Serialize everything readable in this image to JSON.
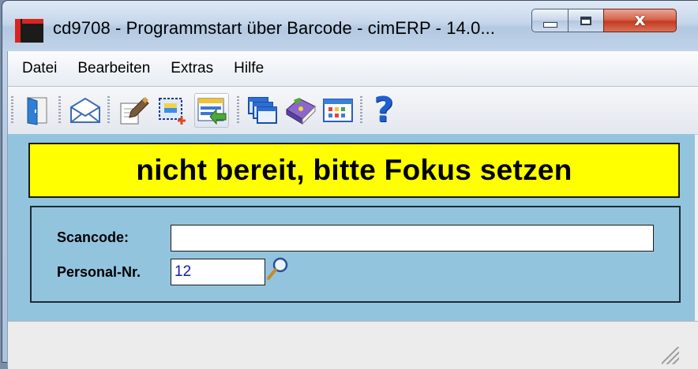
{
  "window": {
    "title": "cd9708  - Programmstart über Barcode - cimERP - 14.0...",
    "close_glyph": "x"
  },
  "menu": {
    "items": [
      "Datei",
      "Bearbeiten",
      "Extras",
      "Hilfe"
    ]
  },
  "toolbar": {
    "icons": [
      "exit-door-icon",
      "mail-icon",
      "edit-document-icon",
      "new-selection-icon",
      "list-import-icon",
      "windows-icon",
      "book-icon",
      "grid-view-icon",
      "help-icon"
    ],
    "help_glyph": "?"
  },
  "banner": {
    "text": "nicht bereit, bitte Fokus setzen",
    "background": "#ffff00"
  },
  "form": {
    "scancode_label": "Scancode:",
    "scancode_value": "",
    "personal_label": "Personal-Nr.",
    "personal_value": "12",
    "panel_color": "#93c4de"
  }
}
